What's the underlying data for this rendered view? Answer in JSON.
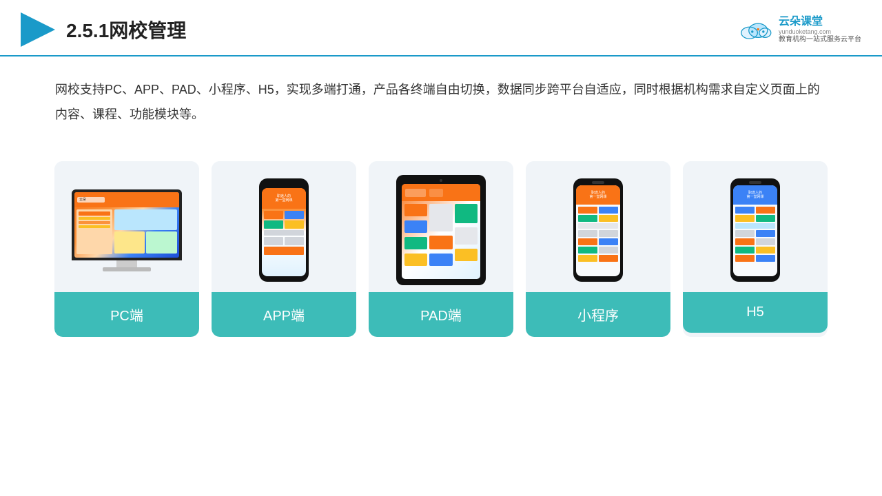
{
  "header": {
    "title": "2.5.1网校管理",
    "logo": {
      "name": "云朵课堂",
      "url": "yunduoketang.com",
      "tagline": "教育机构一站\n式服务云平台"
    }
  },
  "description": {
    "text": "网校支持PC、APP、PAD、小程序、H5，实现多端打通，产品各终端自由切换，数据同步跨平台自适应，同时根据机构需求自定义页面上的内容、课程、功能模块等。"
  },
  "cards": [
    {
      "id": "pc",
      "label": "PC端"
    },
    {
      "id": "app",
      "label": "APP端"
    },
    {
      "id": "pad",
      "label": "PAD端"
    },
    {
      "id": "miniprogram",
      "label": "小程序"
    },
    {
      "id": "h5",
      "label": "H5"
    }
  ],
  "colors": {
    "accent": "#3dbcb8",
    "header_border": "#1a9ac9",
    "logo_color": "#1a9ac9"
  }
}
